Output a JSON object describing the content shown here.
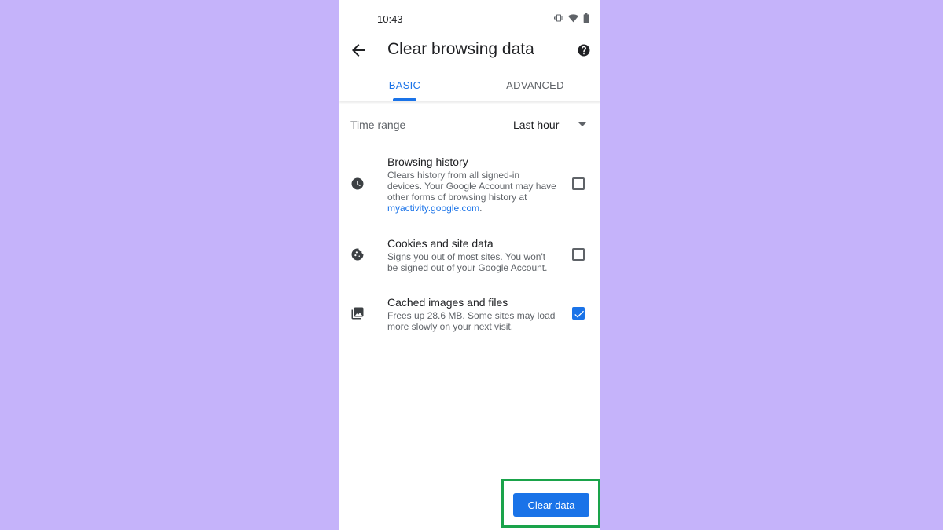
{
  "status_bar": {
    "time": "10:43",
    "icons": [
      "vibrate-icon",
      "wifi-icon",
      "battery-icon"
    ]
  },
  "app_bar": {
    "title": "Clear browsing data",
    "back_icon": "arrow-back-icon",
    "help_icon": "help-icon"
  },
  "tabs": [
    {
      "label": "BASIC",
      "selected": true
    },
    {
      "label": "ADVANCED",
      "selected": false
    }
  ],
  "time_range": {
    "label": "Time range",
    "value": "Last hour"
  },
  "items": [
    {
      "icon": "clock-icon",
      "title": "Browsing history",
      "description": "Clears history from all signed-in devices. Your Google Account may have other forms of browsing history at ",
      "link": "myactivity.google.com",
      "after_link": ".",
      "checked": false
    },
    {
      "icon": "cookie-icon",
      "title": "Cookies and site data",
      "description": "Signs you out of most sites. You won't be signed out of your Google Account.",
      "checked": false
    },
    {
      "icon": "image-icon",
      "title": "Cached images and files",
      "description": "Frees up 28.6 MB. Some sites may load more slowly on your next visit.",
      "checked": true
    }
  ],
  "clear_button": {
    "label": "Clear data"
  },
  "colors": {
    "background": "#c5b3fa",
    "accent": "#1a73e8",
    "highlight": "#1aa34a"
  }
}
